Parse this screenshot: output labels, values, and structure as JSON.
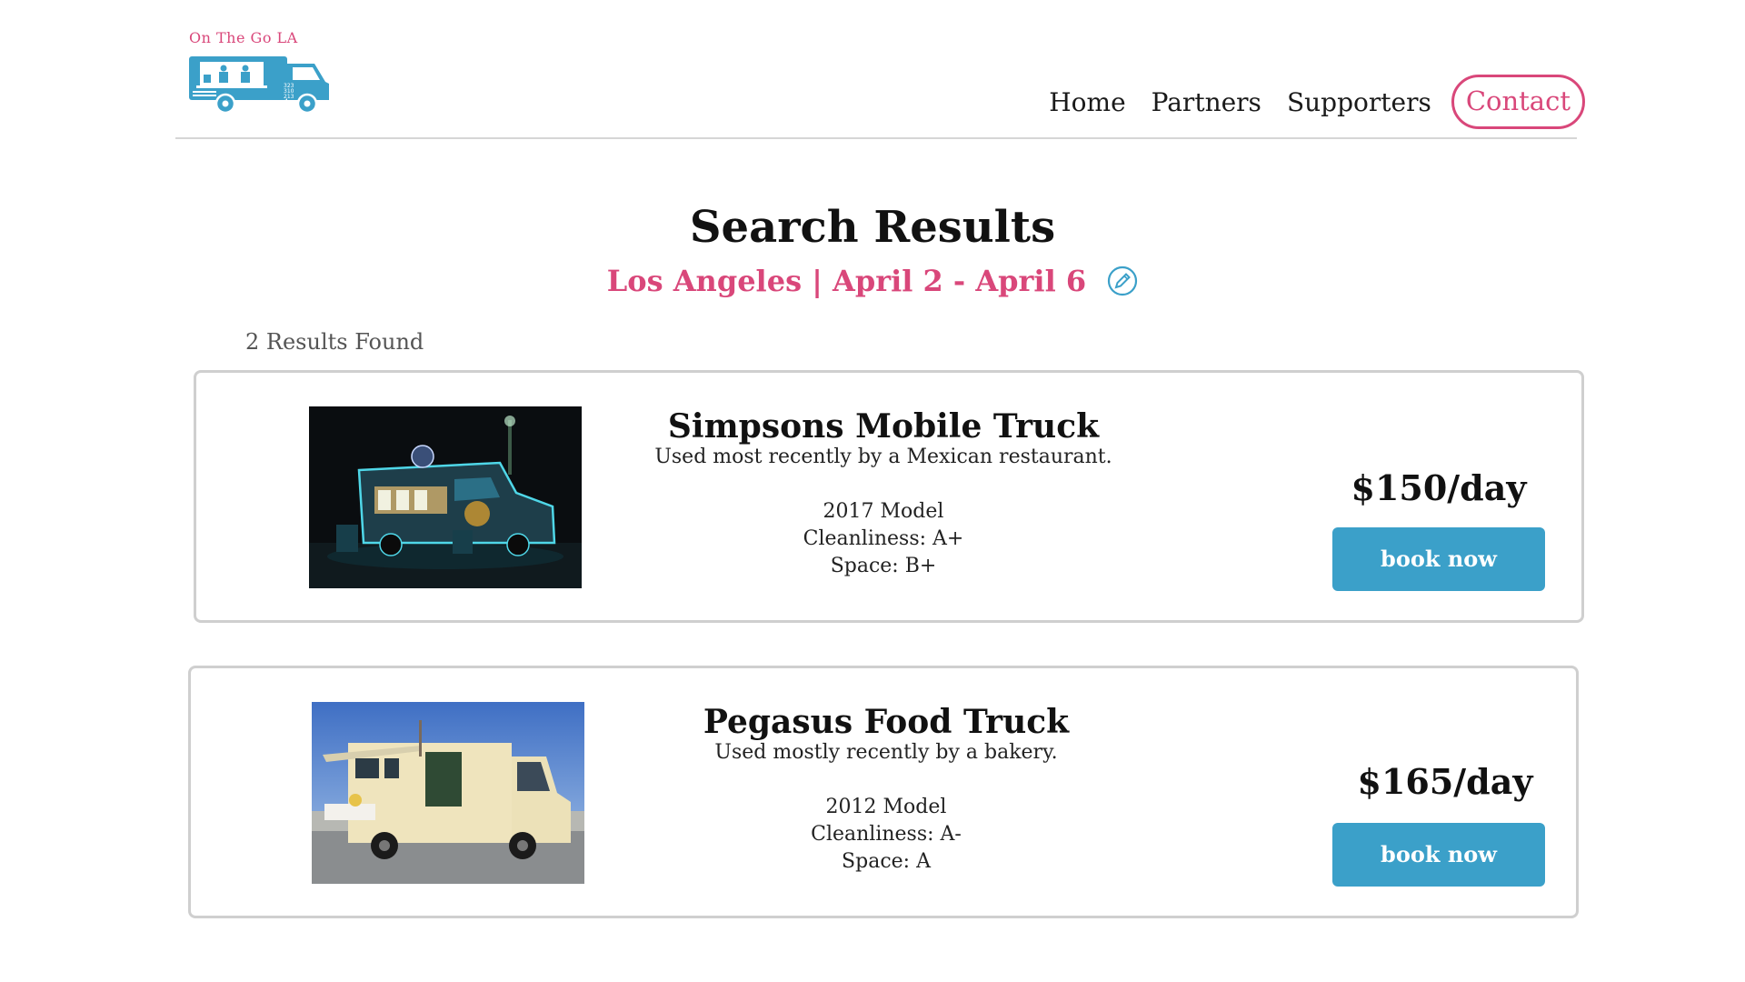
{
  "header": {
    "logo_text": "On The Go LA",
    "truck_number_lines": [
      "323",
      "310",
      "213"
    ],
    "nav": {
      "home": "Home",
      "partners": "Partners",
      "supporters": "Supporters",
      "contact": "Contact"
    }
  },
  "main": {
    "title": "Search Results",
    "subtitle": "Los Angeles | April 2 - April 6",
    "edit_icon": "pencil-icon",
    "results_count": "2 Results Found"
  },
  "results": [
    {
      "name": "Simpsons Mobile Truck",
      "description": "Used most recently by a Mexican restaurant.",
      "model": "2017 Model",
      "cleanliness": "Cleanliness: A+",
      "space": "Space: B+",
      "price": "$150/day",
      "book_label": "book now"
    },
    {
      "name": "Pegasus Food Truck",
      "description": "Used mostly recently by a bakery.",
      "model": "2012 Model",
      "cleanliness": "Cleanliness: A-",
      "space": "Space: A",
      "price": "$165/day",
      "book_label": "book now"
    }
  ],
  "colors": {
    "accent_pink": "#d9477a",
    "button_blue": "#3ba0c9",
    "logo_blue": "#3ba0c9",
    "border_gray": "#cfcfcf"
  }
}
